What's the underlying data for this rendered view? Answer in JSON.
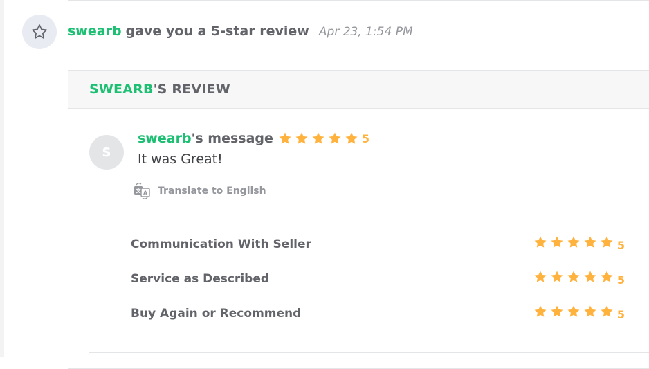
{
  "event": {
    "icon": "star-outline-icon",
    "user": "swearb",
    "text": "gave you a 5-star review",
    "date": "Apr 23, 1:54 PM"
  },
  "review": {
    "header_user": "SWEARB",
    "header_suffix": "'S REVIEW",
    "avatar_letter": "S",
    "message_user": "swearb",
    "message_suffix": "'s message",
    "overall_rating": 5,
    "overall_rating_label": "5",
    "message_text": "It was Great!",
    "translate_label": "Translate to English",
    "ratings": [
      {
        "label": "Communication With Seller",
        "value": 5,
        "value_label": "5"
      },
      {
        "label": "Service as Described",
        "value": 5,
        "value_label": "5"
      },
      {
        "label": "Buy Again or Recommend",
        "value": 5,
        "value_label": "5"
      }
    ]
  },
  "colors": {
    "brand_green": "#1dbf73",
    "star_orange": "#ffb33e",
    "text_dark": "#404145",
    "text_muted": "#95979d"
  }
}
